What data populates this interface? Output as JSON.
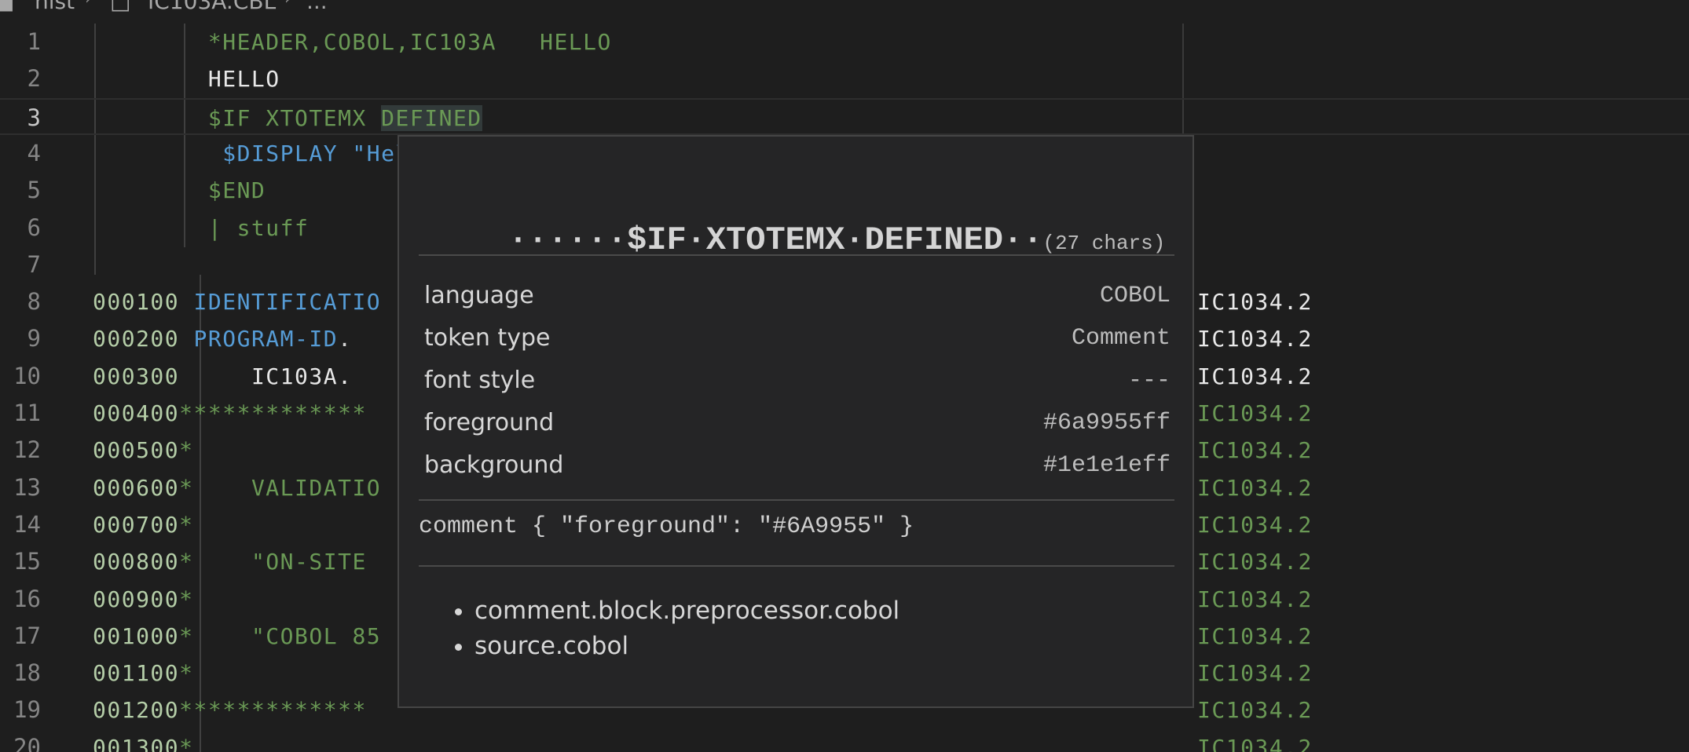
{
  "breadcrumb": {
    "folder": "nist",
    "file": "IC103A.CBL",
    "more": "..."
  },
  "editor": {
    "current_line": 3,
    "lines": [
      {
        "n": "1",
        "segments": [
          {
            "t": "        *HEADER,COBOL,IC103A   HELLO",
            "c": "comment"
          }
        ]
      },
      {
        "n": "2",
        "segments": [
          {
            "t": "        HELLO",
            "c": "white"
          }
        ]
      },
      {
        "n": "3",
        "segments": [
          {
            "t": "        $IF XTOTEMX ",
            "c": "comment"
          },
          {
            "t": "DEFINED",
            "c": "comment",
            "hl": true
          }
        ]
      },
      {
        "n": "4",
        "segments": [
          {
            "t": "         $DISPLAY \"Hel",
            "c": "kw"
          }
        ]
      },
      {
        "n": "5",
        "segments": [
          {
            "t": "        $END",
            "c": "comment"
          }
        ]
      },
      {
        "n": "6",
        "segments": [
          {
            "t": "        | stuff",
            "c": "comment"
          }
        ]
      },
      {
        "n": "7",
        "segments": []
      },
      {
        "n": "8",
        "segments": [
          {
            "t": "000100",
            "c": "seq"
          },
          {
            "t": " IDENTIFICATIO",
            "c": "kw"
          }
        ],
        "tail": {
          "t": "IC1034.2",
          "c": "white"
        }
      },
      {
        "n": "9",
        "segments": [
          {
            "t": "000200",
            "c": "seq"
          },
          {
            "t": " PROGRAM-ID",
            "c": "kw"
          },
          {
            "t": ".",
            "c": "plain"
          }
        ],
        "tail": {
          "t": "IC1034.2",
          "c": "white"
        }
      },
      {
        "n": "10",
        "segments": [
          {
            "t": "000300",
            "c": "seq"
          },
          {
            "t": "     IC103A.",
            "c": "white"
          }
        ],
        "tail": {
          "t": "IC1034.2",
          "c": "white"
        }
      },
      {
        "n": "11",
        "segments": [
          {
            "t": "000400",
            "c": "seq"
          },
          {
            "t": "*************",
            "c": "comment"
          }
        ],
        "tail": {
          "t": "IC1034.2",
          "c": "comment"
        }
      },
      {
        "n": "12",
        "segments": [
          {
            "t": "000500",
            "c": "seq"
          },
          {
            "t": "*",
            "c": "comment"
          }
        ],
        "tail": {
          "t": "IC1034.2",
          "c": "comment"
        }
      },
      {
        "n": "13",
        "segments": [
          {
            "t": "000600",
            "c": "seq"
          },
          {
            "t": "*    VALIDATIO",
            "c": "comment"
          }
        ],
        "tail": {
          "t": "IC1034.2",
          "c": "comment"
        }
      },
      {
        "n": "14",
        "segments": [
          {
            "t": "000700",
            "c": "seq"
          },
          {
            "t": "*",
            "c": "comment"
          }
        ],
        "tail": {
          "t": "IC1034.2",
          "c": "comment"
        }
      },
      {
        "n": "15",
        "segments": [
          {
            "t": "000800",
            "c": "seq"
          },
          {
            "t": "*    \"ON-SITE ",
            "c": "comment"
          }
        ],
        "tail": {
          "t": "IC1034.2",
          "c": "comment"
        }
      },
      {
        "n": "16",
        "segments": [
          {
            "t": "000900",
            "c": "seq"
          },
          {
            "t": "*",
            "c": "comment"
          }
        ],
        "tail": {
          "t": "IC1034.2",
          "c": "comment"
        }
      },
      {
        "n": "17",
        "segments": [
          {
            "t": "001000",
            "c": "seq"
          },
          {
            "t": "*    \"COBOL 85",
            "c": "comment"
          }
        ],
        "tail": {
          "t": "IC1034.2",
          "c": "comment"
        }
      },
      {
        "n": "18",
        "segments": [
          {
            "t": "001100",
            "c": "seq"
          },
          {
            "t": "*",
            "c": "comment"
          }
        ],
        "tail": {
          "t": "IC1034.2",
          "c": "comment"
        }
      },
      {
        "n": "19",
        "segments": [
          {
            "t": "001200",
            "c": "seq"
          },
          {
            "t": "*************",
            "c": "comment"
          }
        ],
        "tail": {
          "t": "IC1034.2",
          "c": "comment"
        }
      },
      {
        "n": "20",
        "segments": [
          {
            "t": "001300",
            "c": "seq"
          },
          {
            "t": "*",
            "c": "comment"
          }
        ],
        "tail": {
          "t": "IC1034.2",
          "c": "comment"
        }
      }
    ]
  },
  "hover": {
    "token_text": "······$IF·XTOTEMX·DEFINED··",
    "char_count": "(27 chars)",
    "properties": [
      {
        "key": "language",
        "value": "COBOL"
      },
      {
        "key": "token type",
        "value": "Comment"
      },
      {
        "key": "font style",
        "value": "---"
      },
      {
        "key": "foreground",
        "value": "#6a9955ff"
      },
      {
        "key": "background",
        "value": "#1e1e1eff"
      }
    ],
    "theme_rule": "comment { \"foreground\": \"#6A9955\" }",
    "scopes": [
      "comment.block.preprocessor.cobol",
      "source.cobol"
    ]
  },
  "colors": {
    "background": "#1e1e1e",
    "comment": "#6a9955",
    "keyword": "#569cd6",
    "sequence": "#b5cea8",
    "line_number": "#858585"
  }
}
